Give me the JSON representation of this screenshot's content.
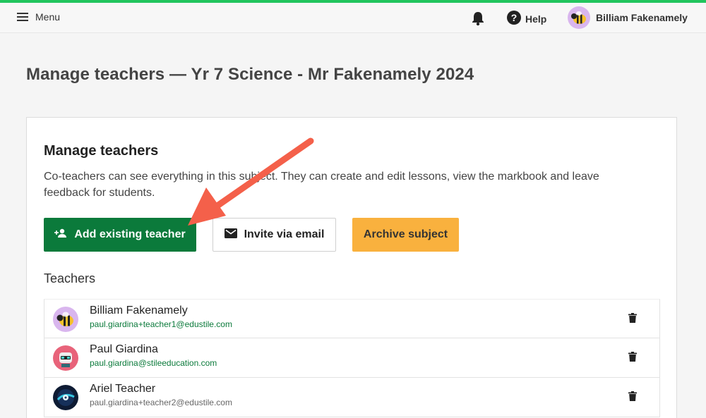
{
  "topbar": {
    "menu_label": "Menu",
    "help_label": "Help",
    "user_name": "Billiam Fakenamely",
    "accent_color": "#22c55e"
  },
  "page": {
    "title": "Manage teachers — Yr 7 Science - Mr Fakenamely 2024"
  },
  "card": {
    "title": "Manage teachers",
    "description": "Co-teachers can see everything in this subject. They can create and edit lessons, view the markbook and leave feedback for students.",
    "buttons": {
      "add_existing": "Add existing teacher",
      "invite_email": "Invite via email",
      "archive": "Archive subject"
    },
    "teachers_label": "Teachers",
    "teachers": [
      {
        "name": "Billiam Fakenamely",
        "email": "paul.giardina+teacher1@edustile.com",
        "email_color": "#0b7a3b",
        "avatar_icon": "bee-icon"
      },
      {
        "name": "Paul Giardina",
        "email": "paul.giardina@stileeducation.com",
        "email_color": "#0b7a3b",
        "avatar_icon": "robot-icon"
      },
      {
        "name": "Ariel Teacher",
        "email": "paul.giardina+teacher2@edustile.com",
        "email_color": "#666666",
        "avatar_icon": "disc-icon"
      }
    ]
  },
  "colors": {
    "primary_button": "#0b7a3b",
    "archive_button": "#f9b13e",
    "annotation_arrow": "#f4604a"
  }
}
